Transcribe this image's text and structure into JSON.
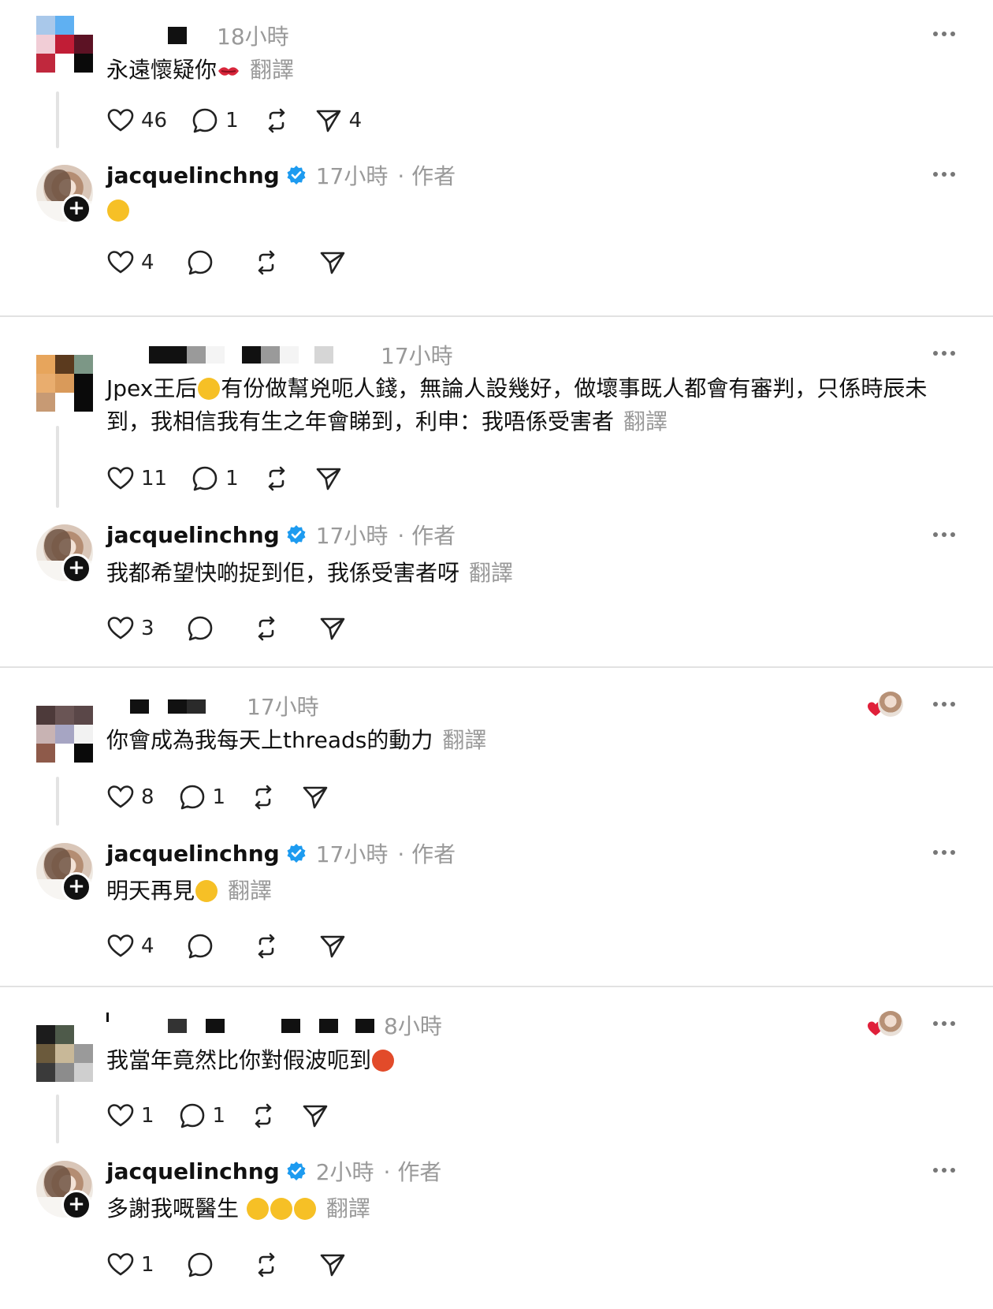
{
  "threads": [
    {
      "comment": {
        "time": "18小時",
        "text": "永遠懷疑你",
        "emoji": "💋",
        "translate": "翻譯",
        "likes": "46",
        "replies": "1",
        "reposts": "",
        "shares": "4"
      },
      "reply": {
        "username": "jacquelinchng",
        "time": "17小時",
        "author": "· 作者",
        "text": "",
        "emoji": "😆",
        "translate": "",
        "likes": "4"
      }
    },
    {
      "comment": {
        "time": "17小時",
        "text": "Jpex王后",
        "emoji": "🤭",
        "text2": "有份做幫兇呃人錢，無論人設幾好，做壞事既人都會有審判，只係時辰未到，我相信我有生之年會睇到，利申：我唔係受害者",
        "translate": "翻譯",
        "likes": "11",
        "replies": "1"
      },
      "reply": {
        "username": "jacquelinchng",
        "time": "17小時",
        "author": "· 作者",
        "text": "我都希望快啲捉到佢，我係受害者呀",
        "translate": "翻譯",
        "likes": "3"
      }
    },
    {
      "comment": {
        "time": "17小時",
        "text": "你會成為我每天上threads的動力",
        "translate": "翻譯",
        "likes": "8",
        "replies": "1"
      },
      "reply": {
        "username": "jacquelinchng",
        "time": "17小時",
        "author": "· 作者",
        "text": "明天再見",
        "emoji": "😬",
        "translate": "翻譯",
        "likes": "4"
      }
    },
    {
      "comment": {
        "time": "8小時",
        "text": "我當年竟然比你對假波呃到",
        "emoji": "🤬",
        "translate": "",
        "likes": "1",
        "replies": "1"
      },
      "reply": {
        "username": "jacquelinchng",
        "time": "2小時",
        "author": "· 作者",
        "text": "多謝我嘅醫生",
        "emoji": "🤭🤭🤣",
        "translate": "翻譯",
        "likes": "1"
      }
    }
  ],
  "icons": {
    "like": "heart-outline-icon",
    "reply": "speech-bubble-icon",
    "repost": "repost-arrows-icon",
    "share": "paper-plane-icon",
    "more": "more-dots-icon",
    "verified": "verified-badge-icon",
    "follow": "plus-icon"
  },
  "colors": {
    "verified": "#1d9bf0",
    "muted": "#999999",
    "divider": "#e2e2e2",
    "liked_heart": "#e0203a"
  }
}
